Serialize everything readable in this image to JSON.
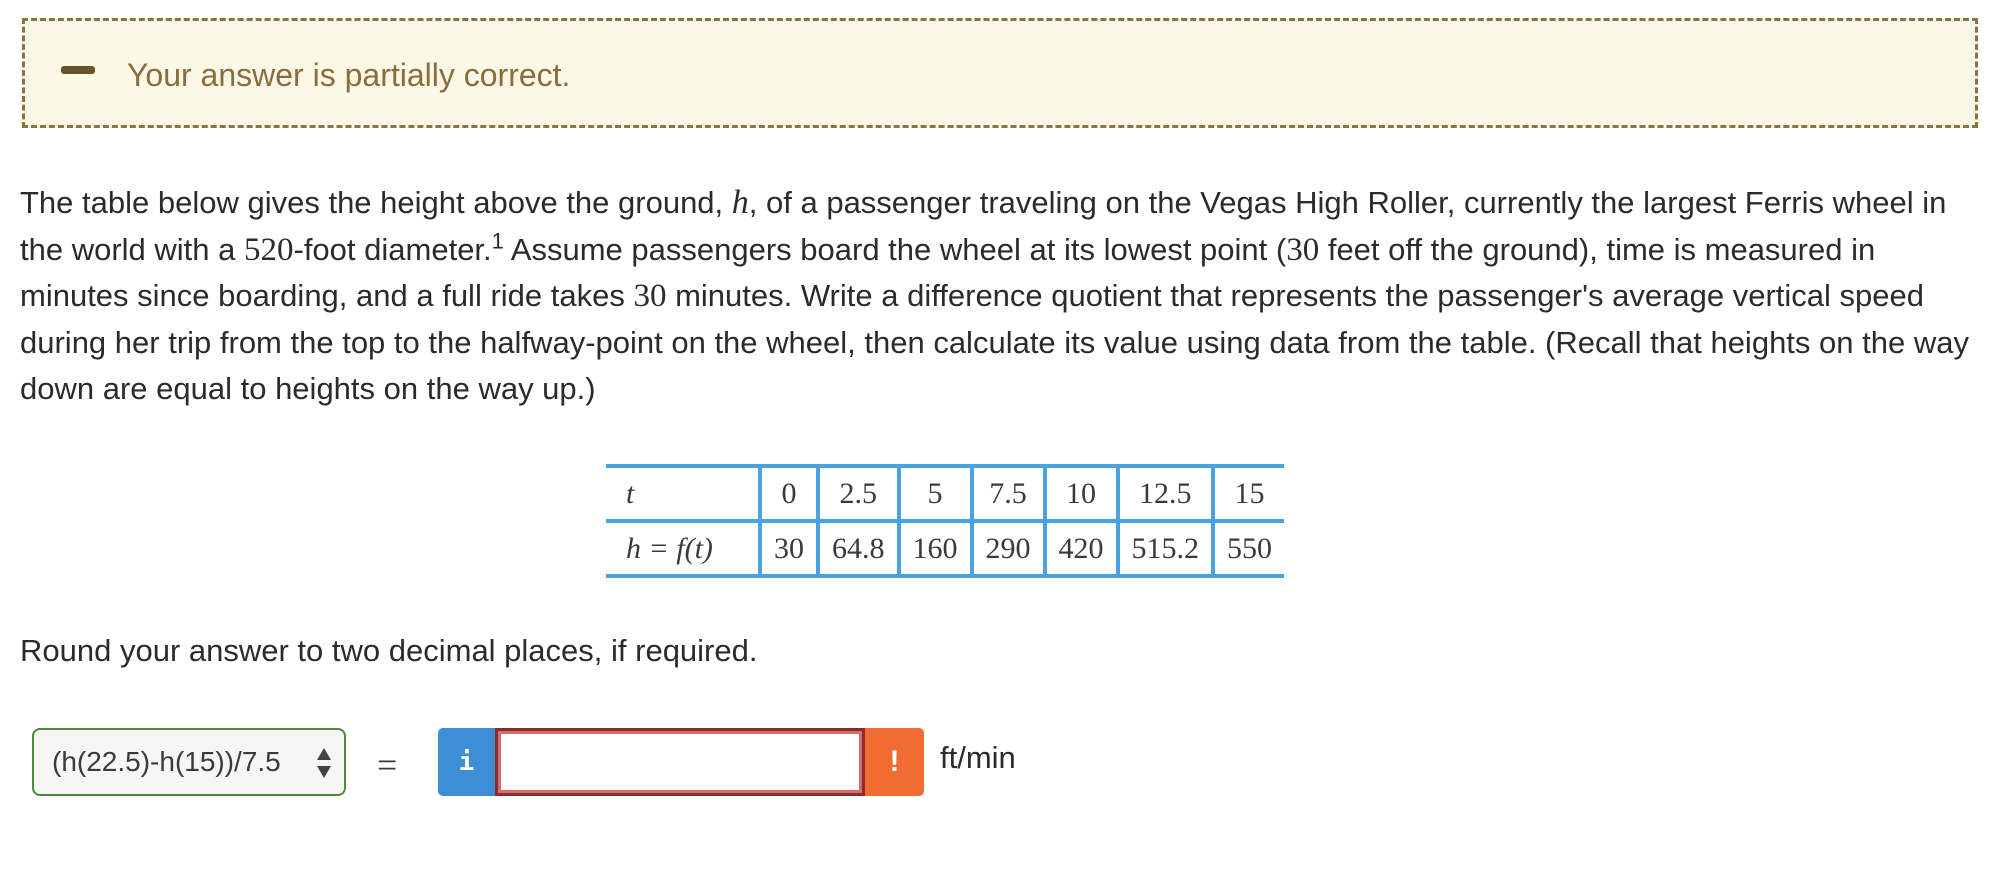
{
  "feedback": {
    "status_text": "Your answer is partially correct.",
    "status_icon": "minus-icon"
  },
  "question": {
    "part1": "The table below gives the height above the ground, ",
    "var_h": "h",
    "part2": ", of a passenger traveling on the Vegas High Roller, currently the largest Ferris wheel in the world with a ",
    "diameter": "520",
    "part3": "-foot diameter.",
    "footnote": "1",
    "part4": " Assume passengers board the wheel at its lowest point (",
    "lowest": "30",
    "part5": " feet off the ground), time is measured in minutes since boarding, and a full ride takes ",
    "ride_time": "30",
    "part6": " minutes. Write a difference quotient that represents the passenger's average vertical speed during her trip from the top to the halfway-point on the wheel, then calculate its value using data from the table. (Recall that heights on the way down are equal to heights on the way up.)"
  },
  "table": {
    "row1_label": "t",
    "row2_label": "h = f(t)",
    "t_values": [
      "0",
      "2.5",
      "5",
      "7.5",
      "10",
      "12.5",
      "15"
    ],
    "h_values": [
      "30",
      "64.8",
      "160",
      "290",
      "420",
      "515.2",
      "550"
    ]
  },
  "instructions": "Round your answer to two decimal places, if required.",
  "answer": {
    "selected_expression": "(h(22.5)-h(15))/7.5",
    "equals": "=",
    "info_label": "i",
    "input_value": "",
    "warning_label": "!",
    "unit": "ft/min"
  }
}
